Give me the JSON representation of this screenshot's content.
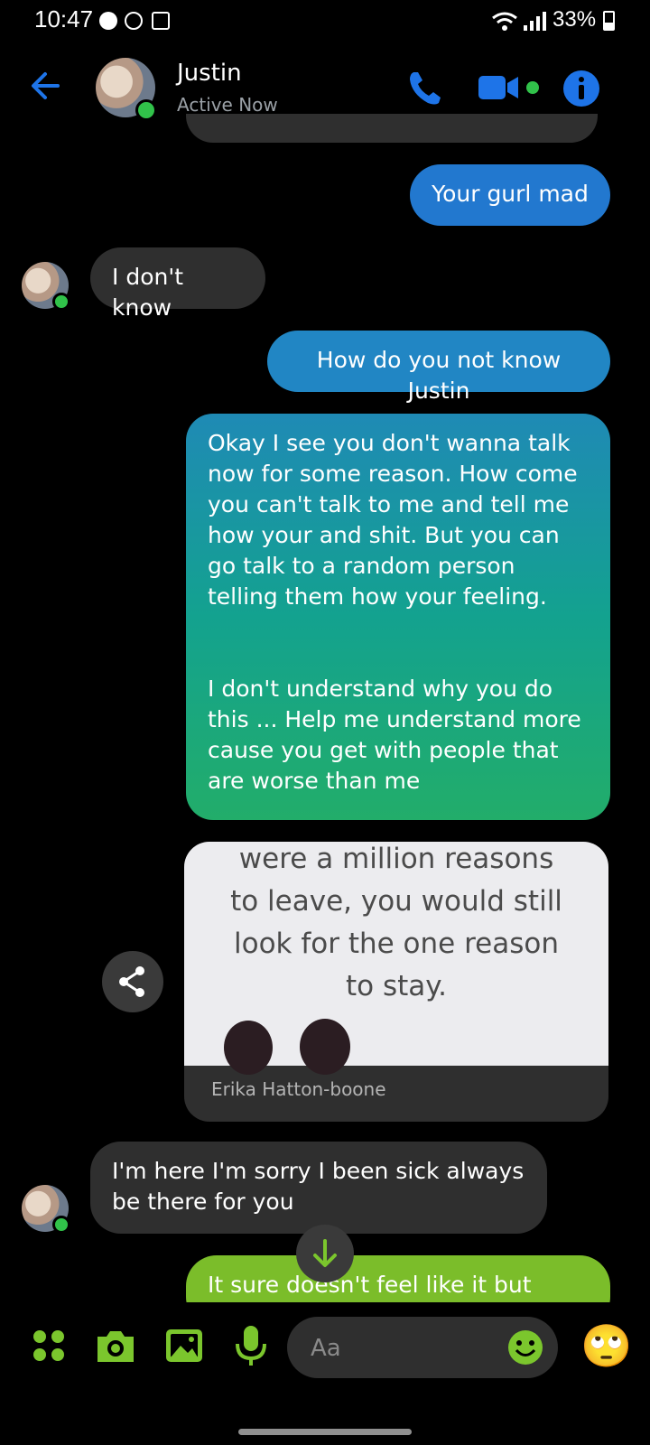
{
  "status_bar": {
    "time": "10:47",
    "battery": "33%",
    "notification_icons": [
      "chat-bubble-icon",
      "messenger-icon",
      "image-icon"
    ],
    "system_icons": [
      "wifi-icon",
      "signal-icon",
      "battery-icon"
    ]
  },
  "header": {
    "name": "Justin",
    "status": "Active Now",
    "actions": [
      "phone-icon",
      "video-icon",
      "info-icon"
    ],
    "accent": "#1e74e8"
  },
  "messages": {
    "m1": "Your gurl mad",
    "m2": "I don't know",
    "m3": "How do you not know Justin",
    "m4_p1": "Okay I see you don't wanna talk now for some reason. How come you can't talk to me and tell me how your and shit. But you can go talk to a random person telling them how your feeling.",
    "m4_p2": "I don't understand why you do this ... Help me understand more cause you get with people that are worse than me",
    "image_quote_l1": "were a million reasons",
    "image_quote_l2": "to leave, you would still",
    "image_quote_l3": "look for the one reason",
    "image_quote_l4": "to stay.",
    "image_sender": "Erika Hatton-boone",
    "m5": "I'm here I'm sorry I been sick always be there for you",
    "m6": "It sure doesn't feel like it but"
  },
  "composer": {
    "placeholder": "Aa",
    "tools": [
      "apps-icon",
      "camera-icon",
      "gallery-icon",
      "microphone-icon",
      "emoji-icon"
    ],
    "quick_reaction": "🙄",
    "accent": "#7bc62d"
  }
}
